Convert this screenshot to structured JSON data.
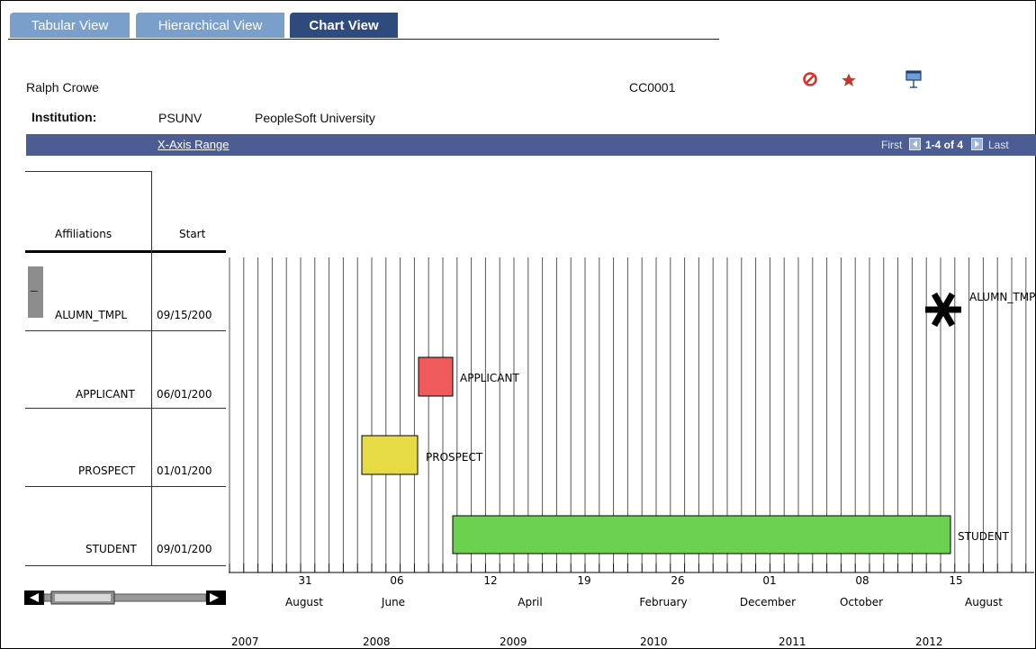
{
  "tabs": [
    {
      "label": "Tabular View",
      "active": false
    },
    {
      "label": "Hierarchical View",
      "active": false
    },
    {
      "label": "Chart View",
      "active": true
    }
  ],
  "person": {
    "name": "Ralph Crowe",
    "id": "CC0001"
  },
  "institution": {
    "label": "Institution:",
    "code": "PSUNV",
    "name": "PeopleSoft University"
  },
  "toolbar": {
    "range_link": "X-Axis Range",
    "first": "First",
    "pager": "1-4 of 4",
    "last": "Last"
  },
  "icons": {
    "cancel": "prohibit-icon",
    "favorite": "star-icon",
    "presentation": "presentation-icon"
  },
  "grid": {
    "headers": {
      "affiliations": "Affiliations",
      "start": "Start"
    },
    "rows": [
      {
        "affiliation": "ALUMN_TMPL",
        "start": "09/15/200"
      },
      {
        "affiliation": "APPLICANT",
        "start": "06/01/200"
      },
      {
        "affiliation": "PROSPECT",
        "start": "01/01/200"
      },
      {
        "affiliation": "STUDENT",
        "start": "09/01/200"
      }
    ],
    "collapse_label": "–"
  },
  "chart_data": {
    "type": "gantt",
    "bars": [
      {
        "label": "APPLICANT",
        "color": "#ef5b5b"
      },
      {
        "label": "PROSPECT",
        "color": "#e6db45"
      },
      {
        "label": "STUDENT",
        "color": "#6bd14f"
      }
    ],
    "milestones": [
      {
        "label": "ALUMN_TMPL",
        "marker": "asterisk"
      }
    ],
    "axis": {
      "days": [
        "31",
        "06",
        "12",
        "19",
        "26",
        "01",
        "08",
        "15"
      ],
      "months": [
        "August",
        "June",
        "April",
        "February",
        "December",
        "October",
        "August"
      ],
      "years": [
        "2007",
        "2008",
        "2009",
        "2010",
        "2011",
        "2012"
      ]
    }
  },
  "colors": {
    "tab_inactive": "#7b9fcb",
    "tab_active": "#2f4a7d",
    "toolbar": "#4c5d93",
    "prohibit": "#d9302a",
    "star": "#c0392b"
  }
}
